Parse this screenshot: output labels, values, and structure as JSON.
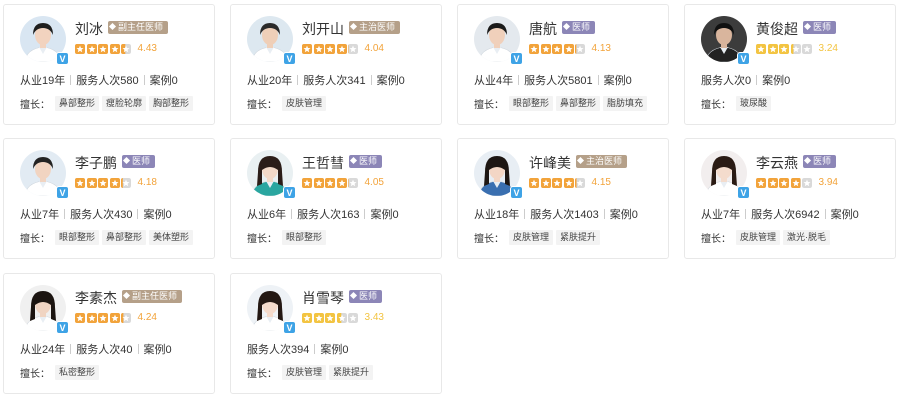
{
  "skills_label": "擅长：",
  "colors": {
    "star_orange": "#f2a33a",
    "star_yellow": "#f3c441",
    "star_empty": "#d9d9d9",
    "score_orange": "#f2a33a",
    "score_yellow": "#f3c441",
    "verified_blue": "#3ea3e6"
  },
  "doctors": [
    {
      "name": "刘冰",
      "title": "副主任医师",
      "title_color": "brown",
      "rating": 4.43,
      "rating_text": "4.43",
      "stats": [
        "从业19年",
        "服务人次580",
        "案例0"
      ],
      "skills": [
        "鼻部整形",
        "瘦脸轮廓",
        "胸部整形"
      ]
    },
    {
      "name": "刘开山",
      "title": "主治医师",
      "title_color": "brown",
      "rating": 4.04,
      "rating_text": "4.04",
      "stats": [
        "从业20年",
        "服务人次341",
        "案例0"
      ],
      "skills": [
        "皮肤管理"
      ]
    },
    {
      "name": "唐航",
      "title": "医师",
      "title_color": "purple",
      "rating": 4.13,
      "rating_text": "4.13",
      "stats": [
        "从业4年",
        "服务人次5801",
        "案例0"
      ],
      "skills": [
        "眼部整形",
        "鼻部整形",
        "脂肪填充"
      ]
    },
    {
      "name": "黄俊超",
      "title": "医师",
      "title_color": "purple",
      "rating": 3.24,
      "rating_text": "3.24",
      "stats": [
        "服务人次0",
        "案例0"
      ],
      "skills": [
        "玻尿酸"
      ]
    },
    {
      "name": "李子鹏",
      "title": "医师",
      "title_color": "purple",
      "rating": 4.18,
      "rating_text": "4.18",
      "stats": [
        "从业7年",
        "服务人次430",
        "案例0"
      ],
      "skills": [
        "眼部整形",
        "鼻部整形",
        "美体塑形"
      ]
    },
    {
      "name": "王哲彗",
      "title": "医师",
      "title_color": "purple",
      "rating": 4.05,
      "rating_text": "4.05",
      "stats": [
        "从业6年",
        "服务人次163",
        "案例0"
      ],
      "skills": [
        "眼部整形"
      ]
    },
    {
      "name": "许峰美",
      "title": "主治医师",
      "title_color": "brown",
      "rating": 4.15,
      "rating_text": "4.15",
      "stats": [
        "从业18年",
        "服务人次1403",
        "案例0"
      ],
      "skills": [
        "皮肤管理",
        "紧肤提升"
      ]
    },
    {
      "name": "李云燕",
      "title": "医师",
      "title_color": "purple",
      "rating": 3.94,
      "rating_text": "3.94",
      "stats": [
        "从业7年",
        "服务人次6942",
        "案例0"
      ],
      "skills": [
        "皮肤管理",
        "激光·脱毛"
      ]
    },
    {
      "name": "李素杰",
      "title": "副主任医师",
      "title_color": "brown",
      "rating": 4.24,
      "rating_text": "4.24",
      "stats": [
        "从业24年",
        "服务人次40",
        "案例0"
      ],
      "skills": [
        "私密整形"
      ]
    },
    {
      "name": "肖雪琴",
      "title": "医师",
      "title_color": "purple",
      "rating": 3.43,
      "rating_text": "3.43",
      "stats": [
        "服务人次394",
        "案例0"
      ],
      "skills": [
        "皮肤管理",
        "紧肤提升"
      ]
    }
  ]
}
